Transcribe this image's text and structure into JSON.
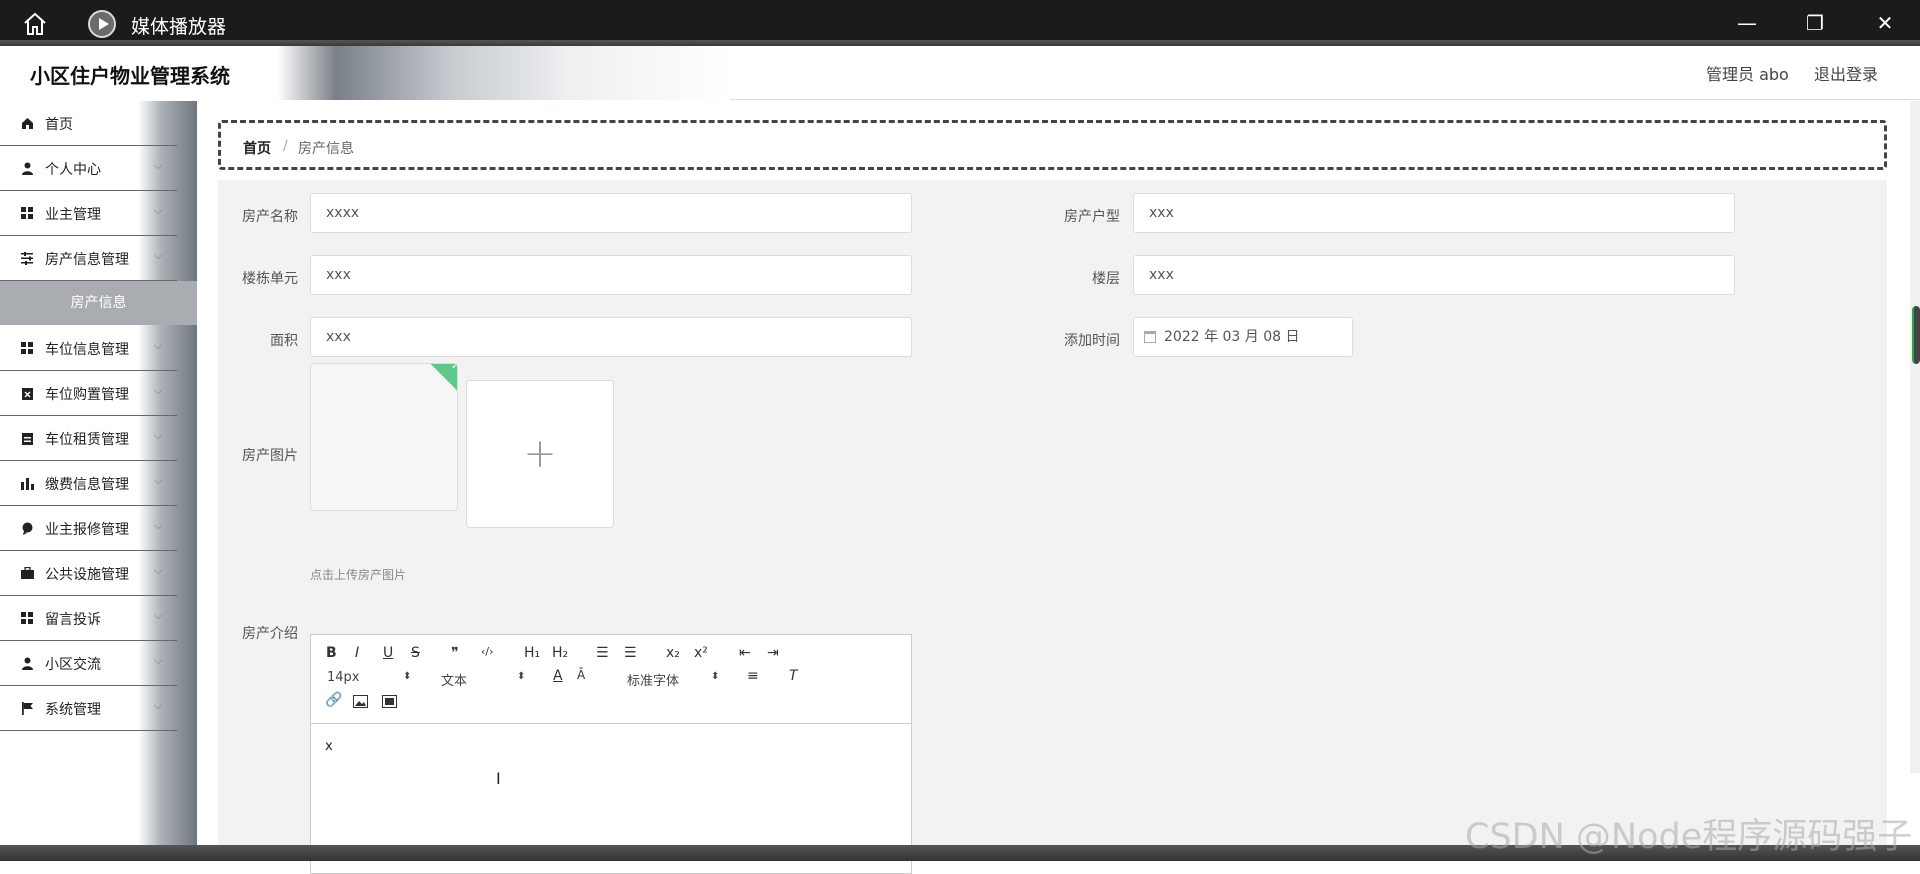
{
  "window": {
    "title": "媒体播放器"
  },
  "header": {
    "brand": "小区住户物业管理系统",
    "admin": "管理员 abo",
    "logout": "退出登录"
  },
  "sidebar": {
    "items": [
      {
        "label": "首页",
        "icon": "home-icon"
      },
      {
        "label": "个人中心",
        "icon": "user-icon"
      },
      {
        "label": "业主管理",
        "icon": "grid-icon"
      },
      {
        "label": "房产信息管理",
        "icon": "sliders-icon"
      },
      {
        "label": "车位信息管理",
        "icon": "grid-icon"
      },
      {
        "label": "车位购置管理",
        "icon": "clipboard-x-icon"
      },
      {
        "label": "车位租赁管理",
        "icon": "clipboard-icon"
      },
      {
        "label": "缴费信息管理",
        "icon": "bar-chart-icon"
      },
      {
        "label": "业主报修管理",
        "icon": "pin-icon"
      },
      {
        "label": "公共设施管理",
        "icon": "briefcase-icon"
      },
      {
        "label": "留言投诉",
        "icon": "grid-icon"
      },
      {
        "label": "小区交流",
        "icon": "user-icon"
      },
      {
        "label": "系统管理",
        "icon": "flag-icon"
      }
    ],
    "active_sub": "房产信息"
  },
  "breadcrumb": {
    "home": "首页",
    "sep": "/",
    "current": "房产信息"
  },
  "form": {
    "name_label": "房产名称",
    "name_value": "xxxx",
    "type_label": "房产户型",
    "type_value": "xxx",
    "unit_label": "楼栋单元",
    "unit_value": "xxx",
    "floor_label": "楼层",
    "floor_value": "xxx",
    "area_label": "面积",
    "area_value": "xxx",
    "date_label": "添加时间",
    "date_value": "2022 年 03 月 08 日",
    "image_label": "房产图片",
    "upload_plus": "+",
    "upload_tip": "点击上传房产图片",
    "intro_label": "房产介绍"
  },
  "editor": {
    "bold": "B",
    "italic": "I",
    "underline": "U",
    "strike": "S",
    "quote": "❞",
    "code": "‹/›",
    "h1": "H₁",
    "h2": "H₂",
    "ol": "☰",
    "ul": "☰",
    "sub": "x₂",
    "sup": "x²",
    "outdent": "⇤",
    "indent": "⇥",
    "size": "14px",
    "header": "文本",
    "font": "标准字体",
    "content": "x"
  },
  "watermark": "CSDN @Node程序源码强子"
}
